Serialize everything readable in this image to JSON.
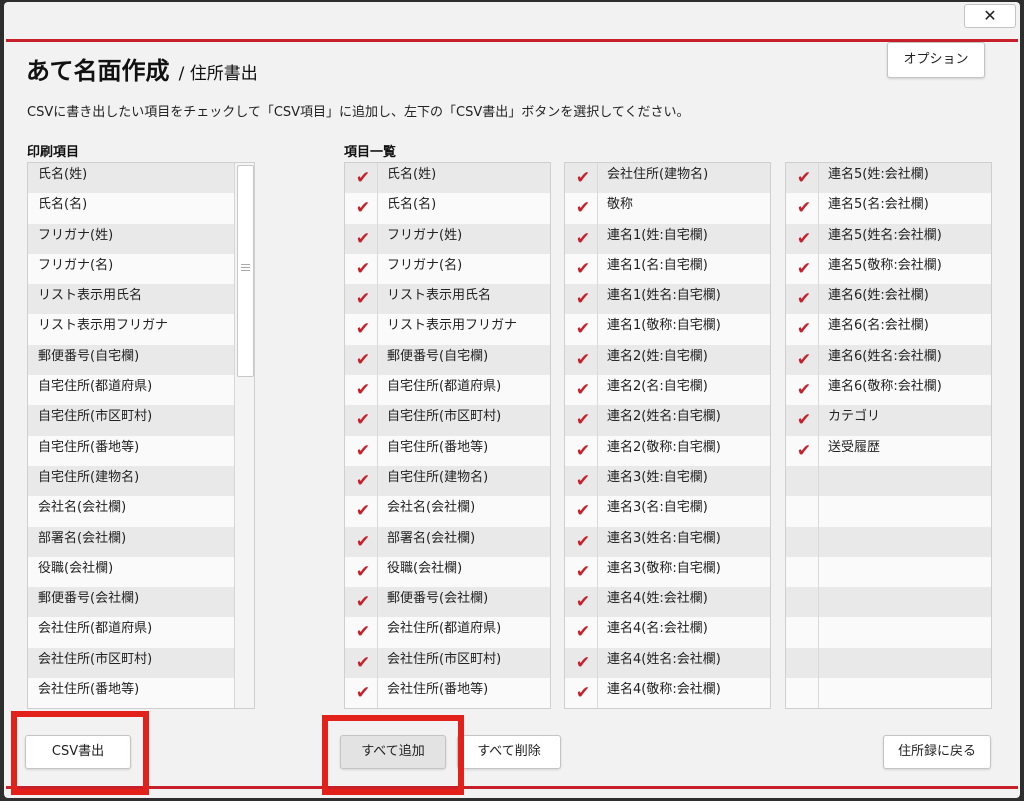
{
  "dialog": {
    "close_glyph": "✕",
    "title": "あて名面作成",
    "subtitle": "/ 住所書出",
    "option_button": "オプション",
    "instruction": "CSVに書き出したい項目をチェックして「CSV項目」に追加し、左下の「CSV書出」ボタンを選択してください。"
  },
  "print_items": {
    "label": "印刷項目",
    "rows": [
      "氏名(姓)",
      "氏名(名)",
      "フリガナ(姓)",
      "フリガナ(名)",
      "リスト表示用氏名",
      "リスト表示用フリガナ",
      "郵便番号(自宅欄)",
      "自宅住所(都道府県)",
      "自宅住所(市区町村)",
      "自宅住所(番地等)",
      "自宅住所(建物名)",
      "会社名(会社欄)",
      "部署名(会社欄)",
      "役職(会社欄)",
      "郵便番号(会社欄)",
      "会社住所(都道府県)",
      "会社住所(市区町村)",
      "会社住所(番地等)"
    ]
  },
  "item_list": {
    "label": "項目一覧",
    "check_glyph": "✔",
    "columns": [
      [
        "氏名(姓)",
        "氏名(名)",
        "フリガナ(姓)",
        "フリガナ(名)",
        "リスト表示用氏名",
        "リスト表示用フリガナ",
        "郵便番号(自宅欄)",
        "自宅住所(都道府県)",
        "自宅住所(市区町村)",
        "自宅住所(番地等)",
        "自宅住所(建物名)",
        "会社名(会社欄)",
        "部署名(会社欄)",
        "役職(会社欄)",
        "郵便番号(会社欄)",
        "会社住所(都道府県)",
        "会社住所(市区町村)",
        "会社住所(番地等)"
      ],
      [
        "会社住所(建物名)",
        "敬称",
        "連名1(姓:自宅欄)",
        "連名1(名:自宅欄)",
        "連名1(姓名:自宅欄)",
        "連名1(敬称:自宅欄)",
        "連名2(姓:自宅欄)",
        "連名2(名:自宅欄)",
        "連名2(姓名:自宅欄)",
        "連名2(敬称:自宅欄)",
        "連名3(姓:自宅欄)",
        "連名3(名:自宅欄)",
        "連名3(姓名:自宅欄)",
        "連名3(敬称:自宅欄)",
        "連名4(姓:会社欄)",
        "連名4(名:会社欄)",
        "連名4(姓名:会社欄)",
        "連名4(敬称:会社欄)"
      ],
      [
        "連名5(姓:会社欄)",
        "連名5(名:会社欄)",
        "連名5(姓名:会社欄)",
        "連名5(敬称:会社欄)",
        "連名6(姓:会社欄)",
        "連名6(名:会社欄)",
        "連名6(姓名:会社欄)",
        "連名6(敬称:会社欄)",
        "カテゴリ",
        "送受履歴"
      ]
    ]
  },
  "buttons": {
    "csv_export": "CSV書出",
    "add_all": "すべて追加",
    "delete_all": "すべて削除",
    "back_to_address_book": "住所録に戻る"
  },
  "colors": {
    "accent_red": "#c8202b",
    "highlight_red": "#e1211a"
  }
}
